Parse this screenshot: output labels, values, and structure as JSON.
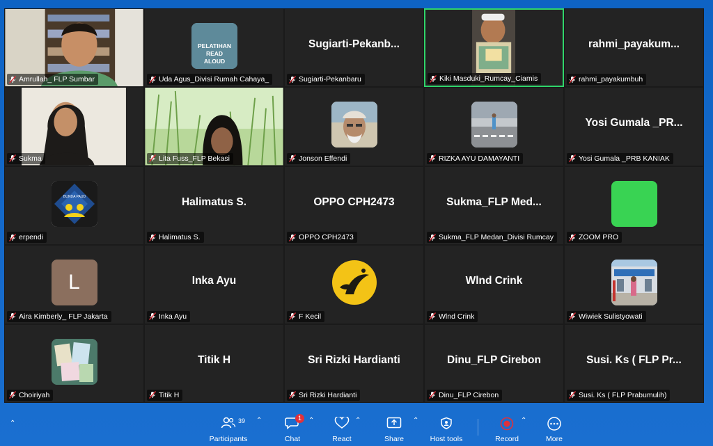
{
  "participants": [
    {
      "name": "Amrullah_ FLP Sumbar",
      "display": "",
      "type": "video-man"
    },
    {
      "name": "Uda Agus_Divisi Rumah Cahaya_",
      "display": "",
      "type": "logo-read"
    },
    {
      "name": "Sugiarti-Pekanbaru",
      "display": "Sugiarti-Pekanb...",
      "type": "text"
    },
    {
      "name": "Kiki Masduki_Rumcay_Ciamis",
      "display": "",
      "type": "video-boy",
      "active": true
    },
    {
      "name": "rahmi_payakumbuh",
      "display": "rahmi_payakum...",
      "type": "text"
    },
    {
      "name": "Sukma",
      "display": "",
      "type": "video-woman"
    },
    {
      "name": "Lita Fuss_FLP Bekasi",
      "display": "",
      "type": "video-grass"
    },
    {
      "name": "Jonson Effendi",
      "display": "",
      "type": "avatar-portrait"
    },
    {
      "name": "RIZKA AYU DAMAYANTI",
      "display": "",
      "type": "avatar-street"
    },
    {
      "name": "Yosi Gumala _PRB KANIAK",
      "display": "Yosi  Gumala _PR...",
      "type": "text"
    },
    {
      "name": "erpendi",
      "display": "",
      "type": "avatar-paud"
    },
    {
      "name": "Halimatus S.",
      "display": "Halimatus S.",
      "type": "text"
    },
    {
      "name": "OPPO CPH2473",
      "display": "OPPO CPH2473",
      "type": "text"
    },
    {
      "name": "Sukma_FLP Medan_Divisi Rumcay",
      "display": "Sukma_FLP  Med...",
      "type": "text"
    },
    {
      "name": "ZOOM PRO",
      "display": "",
      "type": "avatar-green"
    },
    {
      "name": "Aira Kimberly_ FLP Jakarta",
      "display": "",
      "type": "avatar-letter",
      "letter": "L"
    },
    {
      "name": "Inka Ayu",
      "display": "Inka Ayu",
      "type": "text"
    },
    {
      "name": "F Kecil",
      "display": "",
      "type": "avatar-yellow"
    },
    {
      "name": "Wlnd Crink",
      "display": "Wlnd Crink",
      "type": "text"
    },
    {
      "name": "Wiwiek Sulistyowati",
      "display": "",
      "type": "avatar-building"
    },
    {
      "name": "Choiriyah",
      "display": "",
      "type": "avatar-books"
    },
    {
      "name": "Titik H",
      "display": "Titik H",
      "type": "text"
    },
    {
      "name": "Sri Rizki Hardianti",
      "display": "Sri Rizki Hardianti",
      "type": "text"
    },
    {
      "name": "Dinu_FLP Cirebon",
      "display": "Dinu_FLP Cirebon",
      "type": "text"
    },
    {
      "name": "Susi. Ks ( FLP Prabumulih)",
      "display": "Susi.  Ks  ( FLP Pr...",
      "type": "text"
    }
  ],
  "logo_text": "PELATIHAN READ ALOUD",
  "paud_text": "BUNDA PAUD",
  "toolbar": {
    "participants_label": "Participants",
    "participants_count": "39",
    "chat_label": "Chat",
    "chat_badge": "1",
    "react_label": "React",
    "share_label": "Share",
    "host_tools_label": "Host tools",
    "record_label": "Record",
    "more_label": "More"
  },
  "colors": {
    "accent_active": "#2fd56a",
    "record": "#e0313b",
    "toolbar_bg": "#0e63c4"
  }
}
